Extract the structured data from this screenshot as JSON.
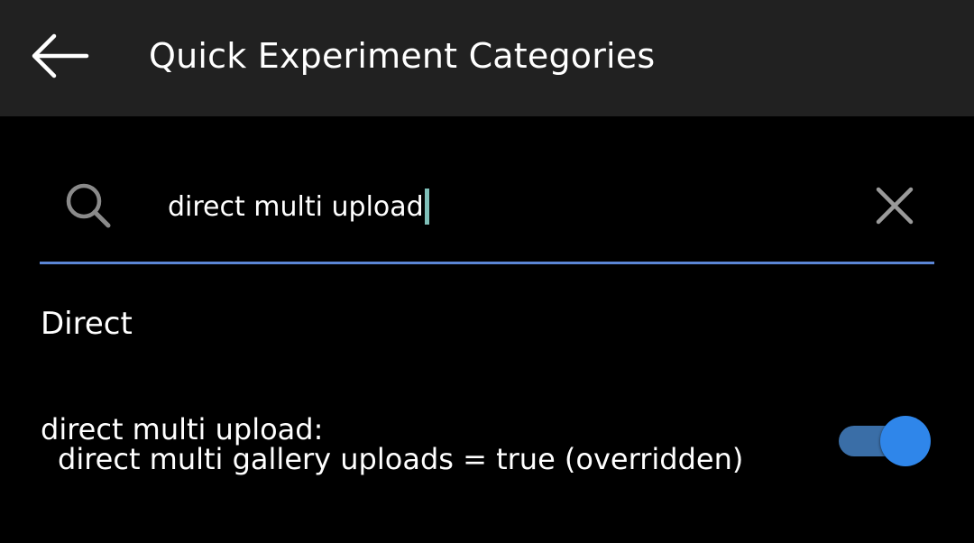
{
  "header": {
    "title": "Quick Experiment Categories",
    "back_icon": "arrow-left-icon"
  },
  "search": {
    "icon": "search-icon",
    "value": "direct multi upload",
    "clear_icon": "close-icon",
    "accent_color": "#5b86d6",
    "caret_color": "#7fbfb8"
  },
  "results": {
    "section_title": "Direct",
    "items": [
      {
        "title": "direct multi upload:",
        "subtitle": "direct multi gallery uploads = true (overridden)",
        "toggle_on": true,
        "toggle_color": "#2f86ea"
      }
    ]
  }
}
